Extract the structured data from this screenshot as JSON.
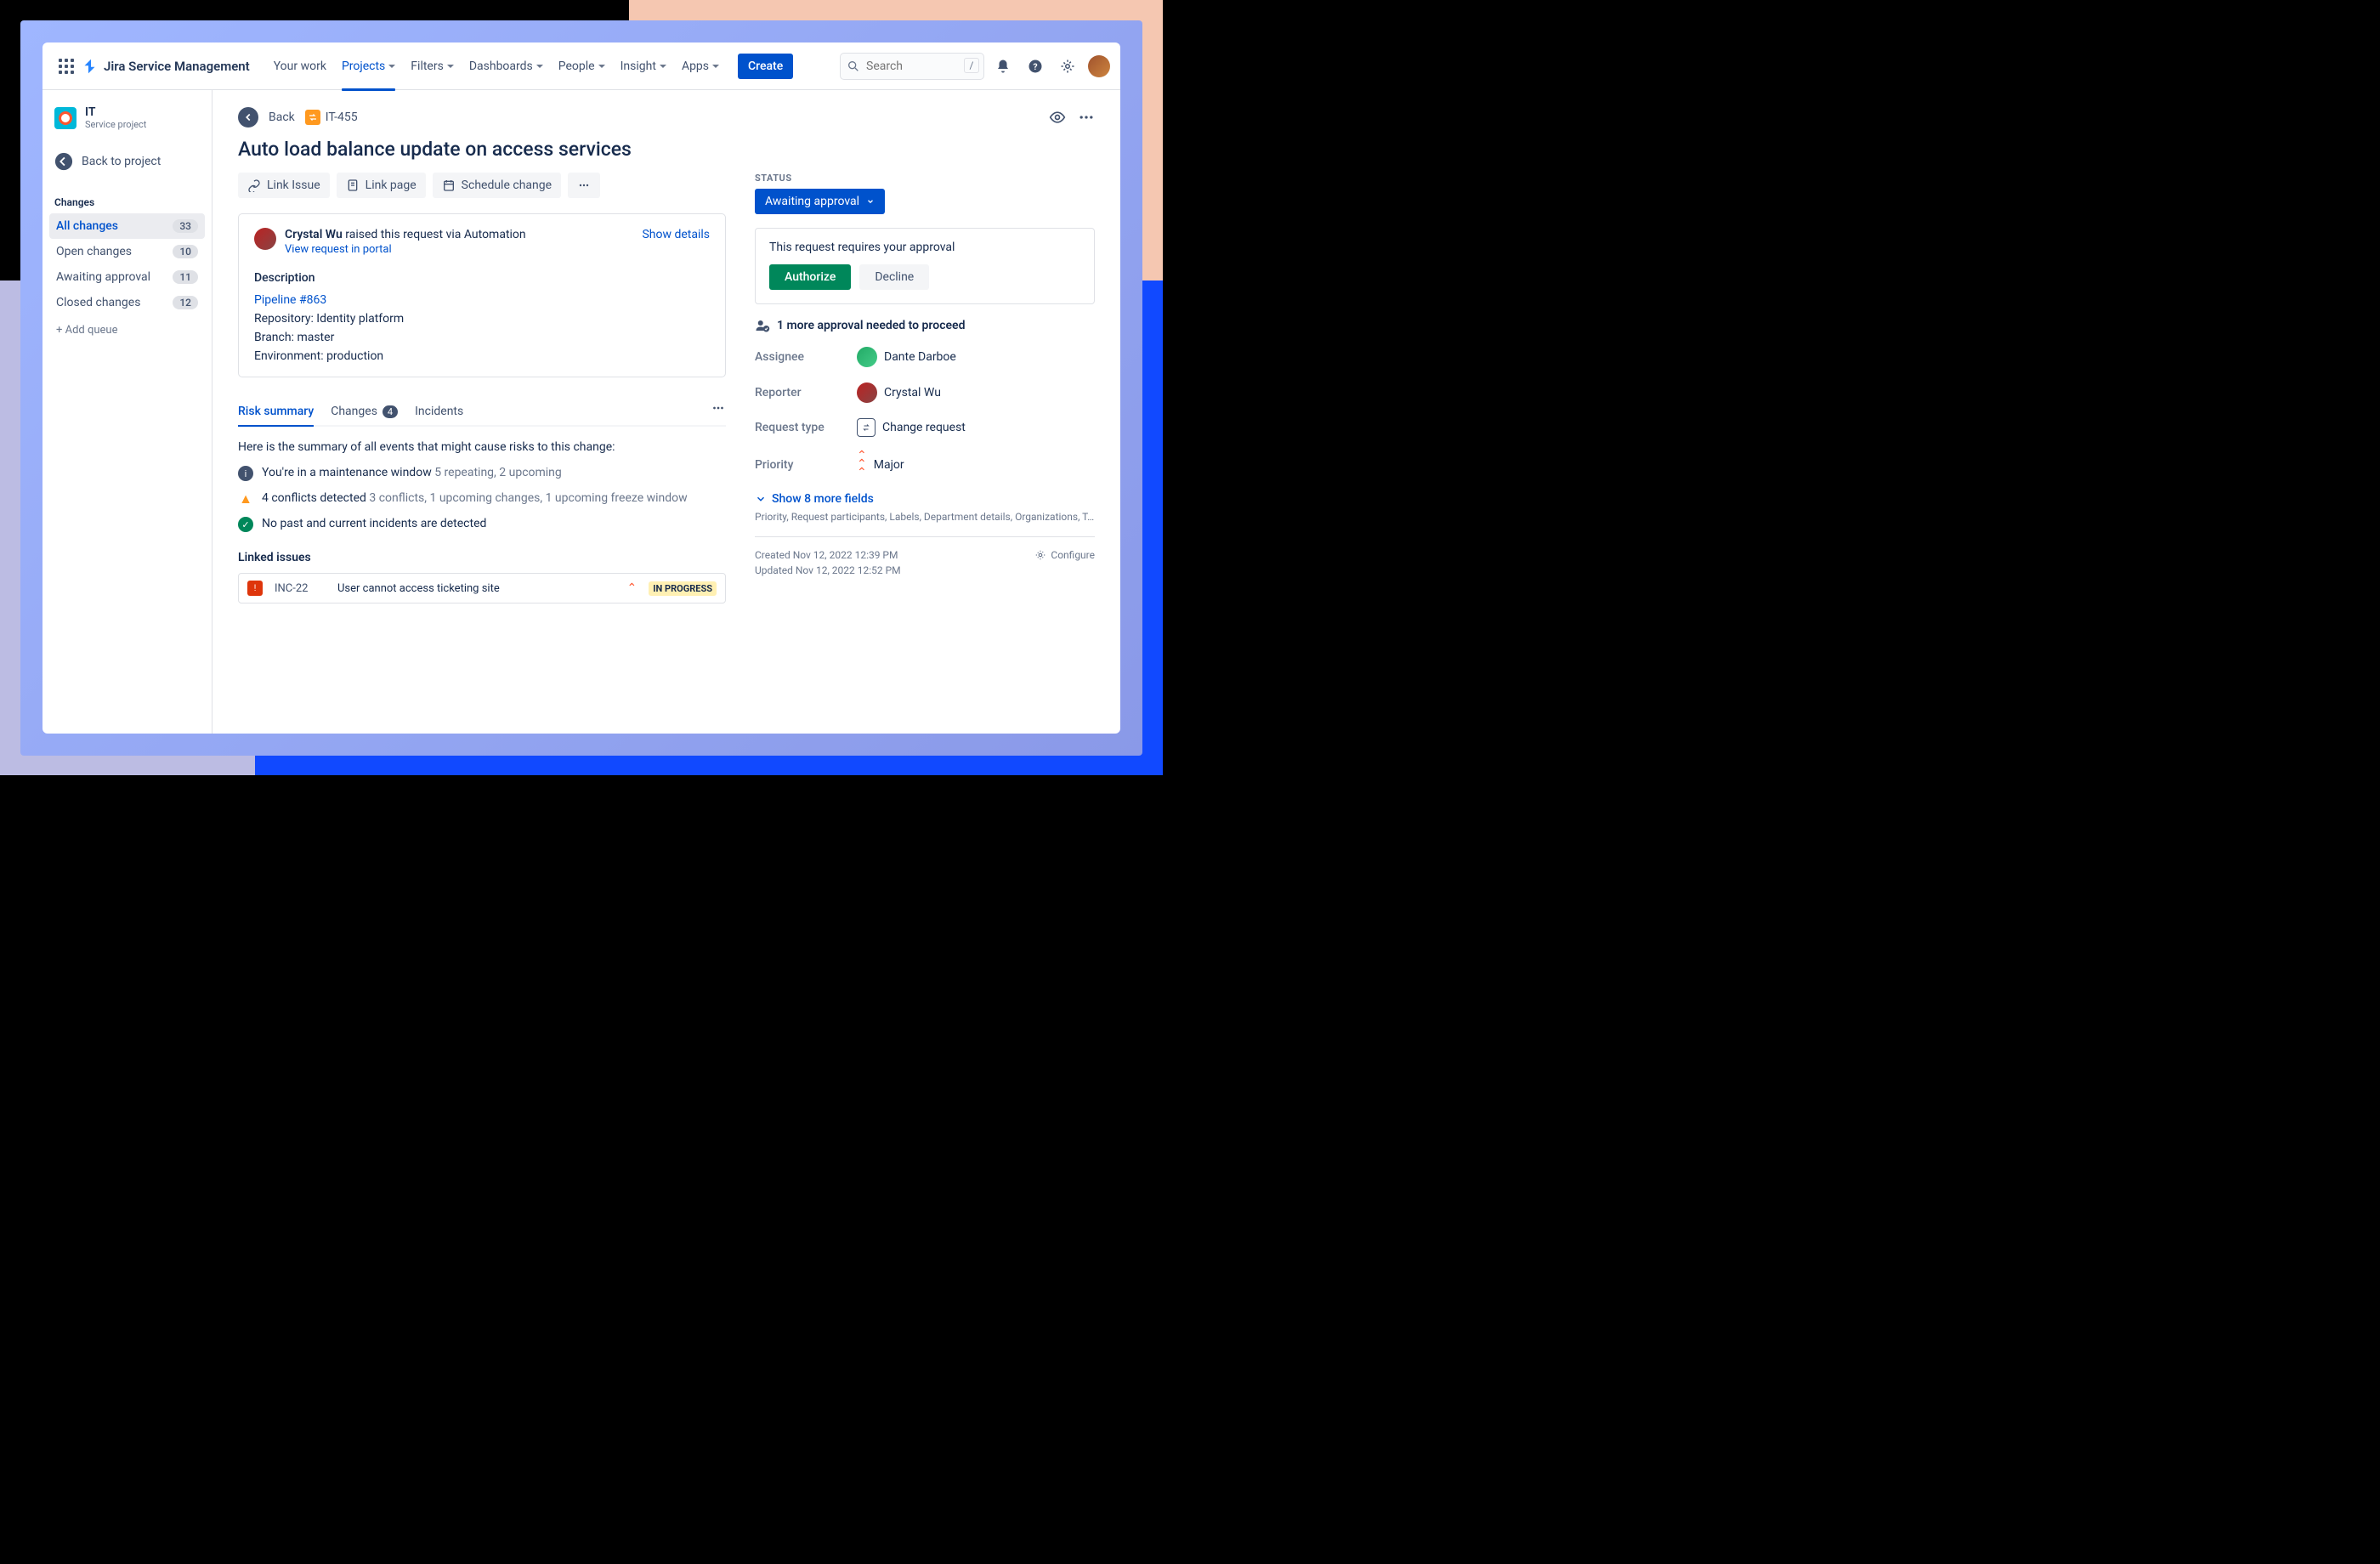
{
  "header": {
    "product": "Jira Service Management",
    "nav": [
      "Your work",
      "Projects",
      "Filters",
      "Dashboards",
      "People",
      "Insight",
      "Apps"
    ],
    "active_nav": "Projects",
    "create": "Create",
    "search_placeholder": "Search",
    "search_shortcut": "/"
  },
  "sidebar": {
    "project_name": "IT",
    "project_type": "Service project",
    "back_to_project": "Back to project",
    "section": "Changes",
    "queues": [
      {
        "label": "All changes",
        "count": "33",
        "active": true
      },
      {
        "label": "Open changes",
        "count": "10"
      },
      {
        "label": "Awaiting approval",
        "count": "11"
      },
      {
        "label": "Closed changes",
        "count": "12"
      }
    ],
    "add_queue": "+ Add queue"
  },
  "issue": {
    "back": "Back",
    "key": "IT-455",
    "title": "Auto load balance update on access services",
    "actions": {
      "link_issue": "Link Issue",
      "link_page": "Link page",
      "schedule": "Schedule change"
    },
    "requester": {
      "name": "Crystal Wu",
      "suffix": " raised this request via Automation",
      "view_portal": "View request in portal",
      "show_details": "Show details"
    },
    "description": {
      "heading": "Description",
      "pipeline": "Pipeline #863",
      "repo": "Repository: Identity platform",
      "branch": "Branch: master",
      "env": "Environment: production"
    },
    "tabs": {
      "risk": "Risk summary",
      "changes": "Changes",
      "changes_count": "4",
      "incidents": "Incidents"
    },
    "risk": {
      "intro": "Here is the summary of all events that might cause risks to this change:",
      "r1_main": "You're in a maintenance window ",
      "r1_sub": "5 repeating, 2 upcoming",
      "r2_main": "4 conflicts detected  ",
      "r2_sub": "3 conflicts, 1 upcoming changes, 1 upcoming freeze window",
      "r3_main": "No past and current incidents are detected"
    },
    "linked": {
      "heading": "Linked issues",
      "key": "INC-22",
      "title": "User cannot access ticketing site",
      "status": "IN PROGRESS"
    }
  },
  "details": {
    "status_label": "STATUS",
    "status_value": "Awaiting approval",
    "approval": {
      "text": "This request requires your approval",
      "authorize": "Authorize",
      "decline": "Decline"
    },
    "approval_note": "1 more approval needed to proceed",
    "fields": {
      "assignee_label": "Assignee",
      "assignee": "Dante Darboe",
      "reporter_label": "Reporter",
      "reporter": "Crystal Wu",
      "reqtype_label": "Request type",
      "reqtype": "Change request",
      "priority_label": "Priority",
      "priority": "Major"
    },
    "show_more": "Show 8 more fields",
    "more_hint": "Priority, Request participants, Labels, Department details, Organizations, T...",
    "created": "Created Nov 12, 2022 12:39 PM",
    "updated": "Updated Nov 12, 2022 12:52 PM",
    "configure": "Configure"
  }
}
